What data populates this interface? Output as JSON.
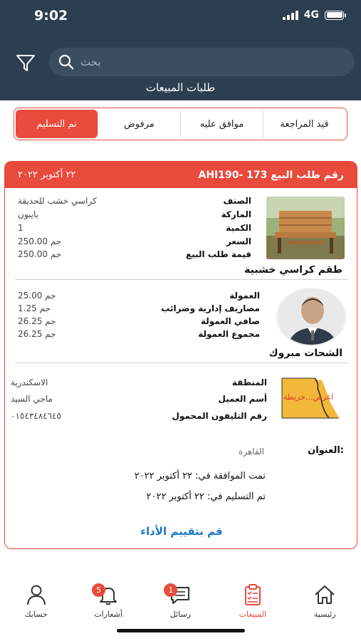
{
  "status": {
    "time": "9:02",
    "network": "4G"
  },
  "search": {
    "placeholder": "بحث"
  },
  "header": {
    "title": "طلبات المبيعات"
  },
  "tabs": [
    {
      "label": "قيد المراجعة"
    },
    {
      "label": "موافق عليه"
    },
    {
      "label": "مرفوض"
    },
    {
      "label": "تم التسليم",
      "active": true
    }
  ],
  "order": {
    "number": "رقم طلب البيع 173 -AHI190",
    "date": "٢٢ أكتوبر ٢٠٢٢",
    "product": {
      "caption": "طقم كراسي خشبية",
      "fields": [
        {
          "label": "الصنف",
          "value": "كراسي خشب للحديقة"
        },
        {
          "label": "الماركة",
          "value": "بايبون"
        },
        {
          "label": "الكمية",
          "value": "1"
        },
        {
          "label": "السعر",
          "value": "جم   250.00"
        },
        {
          "label": "قيمة طلب البيع",
          "value": "جم   250.00"
        }
      ]
    },
    "agent": {
      "caption": "الشحات مبروك",
      "fields": [
        {
          "label": "العمولة",
          "value": "جم   25.00"
        },
        {
          "label": "مصاريف إدارية وضرائب",
          "value": "جم   1.25"
        },
        {
          "label": "صافي العمولة",
          "value": "جم   26.25"
        },
        {
          "label": "مجموع العمولة",
          "value": "جم   26.25"
        }
      ]
    },
    "customer": {
      "map_label": "اعرض...خريطة",
      "fields": [
        {
          "label": "المنطقة",
          "value": "الاسكندرية"
        },
        {
          "label": "أسم العميل",
          "value": "ماجي السيد"
        },
        {
          "label": "رقم التليفون المحمول",
          "value": "٠١٥٤٣٤٨٤٦٤٥"
        }
      ]
    },
    "address": {
      "label": "العنوان:",
      "value": "القاهرة"
    },
    "approved": "تمت الموافقة في: ٢٢ أكتوبر ٢٠٢٢",
    "delivered": "تم التسليم في: ٢٢ أكتوبر ٢٠٢٢",
    "rate_link": "قم بتقييم الأداء"
  },
  "nav": [
    {
      "label": "رئيسية",
      "icon": "home-icon"
    },
    {
      "label": "المبيعات",
      "icon": "clipboard-icon",
      "active": true
    },
    {
      "label": "رسائل",
      "icon": "chat-icon",
      "badge": "1"
    },
    {
      "label": "أشعارات",
      "icon": "bell-icon",
      "badge": "5"
    },
    {
      "label": "حسابك",
      "icon": "user-icon"
    }
  ],
  "colors": {
    "header_bg": "#2c3e50",
    "accent": "#e84a3c",
    "link": "#1e78c8"
  }
}
